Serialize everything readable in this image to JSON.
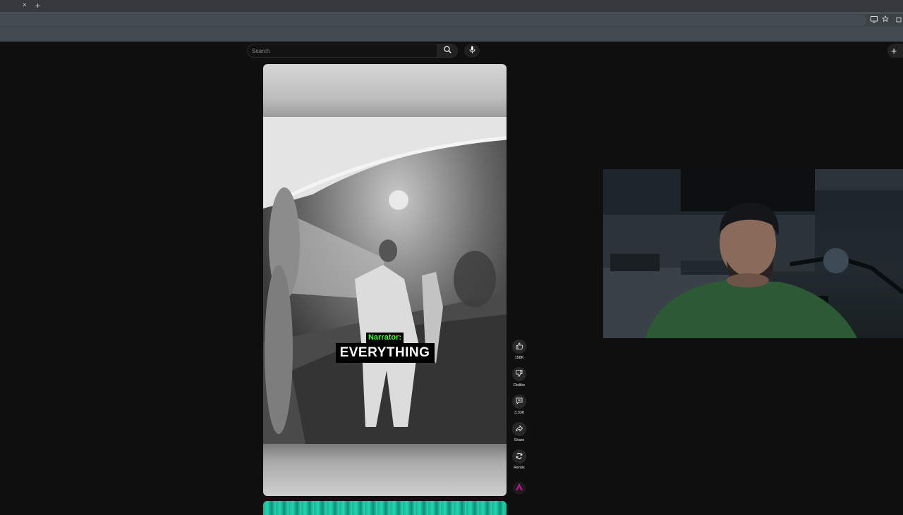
{
  "browser": {
    "tab_close_glyph": "×",
    "new_tab_glyph": "+",
    "icons": [
      "cast-icon",
      "bookmark-star-icon",
      "extensions-icon"
    ]
  },
  "header": {
    "search": {
      "placeholder": "Search",
      "value": ""
    },
    "search_icon": "search-icon",
    "mic_icon": "mic-icon",
    "create_glyph": "+"
  },
  "short": {
    "caption": {
      "speaker": "Narrator:",
      "text": "EVERYTHING"
    },
    "actions": {
      "like_count": "158K",
      "dislike_label": "Dislike",
      "comment_count": "3,338",
      "share_label": "Share",
      "remix_label": "Remix"
    }
  },
  "colors": {
    "page_bg": "#0f0f0f",
    "caption_speaker": "#4cff3d",
    "next_short_accent": "#22d5b0",
    "avatar_accent": "#c21aa0"
  }
}
